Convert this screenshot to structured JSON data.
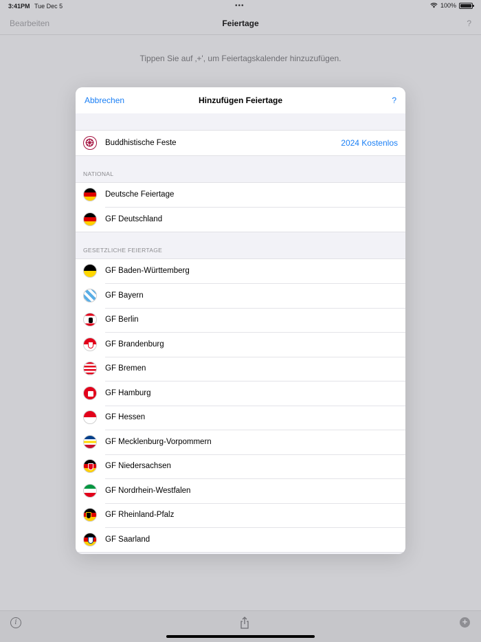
{
  "status_bar": {
    "time": "3:41PM",
    "date": "Tue Dec 5",
    "dots": "•••",
    "battery": "100%"
  },
  "nav": {
    "edit": "Bearbeiten",
    "title": "Feiertage",
    "help": "?"
  },
  "hint": "Tippen Sie auf ‚+', um Feiertagskalender hinzuzufügen.",
  "modal": {
    "cancel": "Abbrechen",
    "title": "Hinzufügen Feiertage",
    "help": "?",
    "featured": {
      "label": "Buddhistische Feste",
      "accessory": "2024 Kostenlos",
      "icon": "dharma-wheel-icon"
    },
    "sections": [
      {
        "header": "NATIONAL",
        "items": [
          {
            "label": "Deutsche Feiertage",
            "flag": "de"
          },
          {
            "label": "GF Deutschland",
            "flag": "de"
          }
        ]
      },
      {
        "header": "GESETZLICHE FEIERTAGE",
        "items": [
          {
            "label": "GF Baden-Württemberg",
            "flag": "bw"
          },
          {
            "label": "GF Bayern",
            "flag": "by"
          },
          {
            "label": "GF Berlin",
            "flag": "be"
          },
          {
            "label": "GF Brandenburg",
            "flag": "bb"
          },
          {
            "label": "GF Bremen",
            "flag": "hb"
          },
          {
            "label": "GF Hamburg",
            "flag": "hh"
          },
          {
            "label": "GF Hessen",
            "flag": "he"
          },
          {
            "label": "GF Mecklenburg-Vorpommern",
            "flag": "mv"
          },
          {
            "label": "GF Niedersachsen",
            "flag": "ni"
          },
          {
            "label": "GF Nordrhein-Westfalen",
            "flag": "nw"
          },
          {
            "label": "GF Rheinland-Pfalz",
            "flag": "rp"
          },
          {
            "label": "GF Saarland",
            "flag": "sl"
          }
        ]
      }
    ]
  },
  "toolbar": {
    "info_icon": "info-icon",
    "share_icon": "share-icon",
    "add_icon": "add-icon"
  },
  "colors": {
    "accent": "#1a7ff5",
    "dimmed_background": "#cfcfd3"
  }
}
